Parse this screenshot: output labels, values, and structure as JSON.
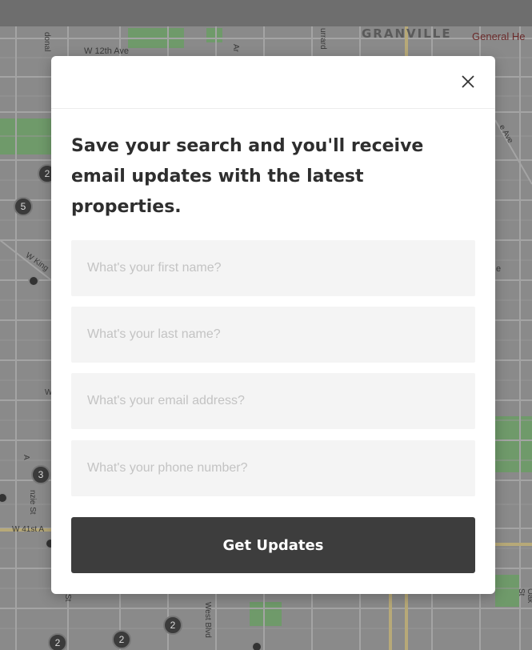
{
  "map": {
    "labels": {
      "w12th": "W 12th Ave",
      "granville": "GRANVILLE",
      "general": "General He",
      "donald": "donal",
      "arb": "Ar",
      "urrard": "urrard",
      "wking": "W King",
      "ave_r": "e Ave",
      "w41st": "W 41st A",
      "kenzie": "nzie St",
      "westblvd": "West Blvd",
      "oak": "Oak St",
      "st": "St",
      "w_left": "W",
      "ce": "e",
      "a_left": "A"
    },
    "clusters": {
      "c1": "5",
      "c2": "2",
      "c3": "3",
      "c4": "2",
      "c5": "2",
      "c6": "2"
    }
  },
  "modal": {
    "close_icon": "close-icon",
    "title": "Save your search and you'll receive email updates with the latest properties.",
    "fields": {
      "first_name": {
        "placeholder": "What's your first name?",
        "value": ""
      },
      "last_name": {
        "placeholder": "What's your last name?",
        "value": ""
      },
      "email": {
        "placeholder": "What's your email address?",
        "value": ""
      },
      "phone": {
        "placeholder": "What's your phone number?",
        "value": ""
      }
    },
    "submit_label": "Get Updates"
  }
}
